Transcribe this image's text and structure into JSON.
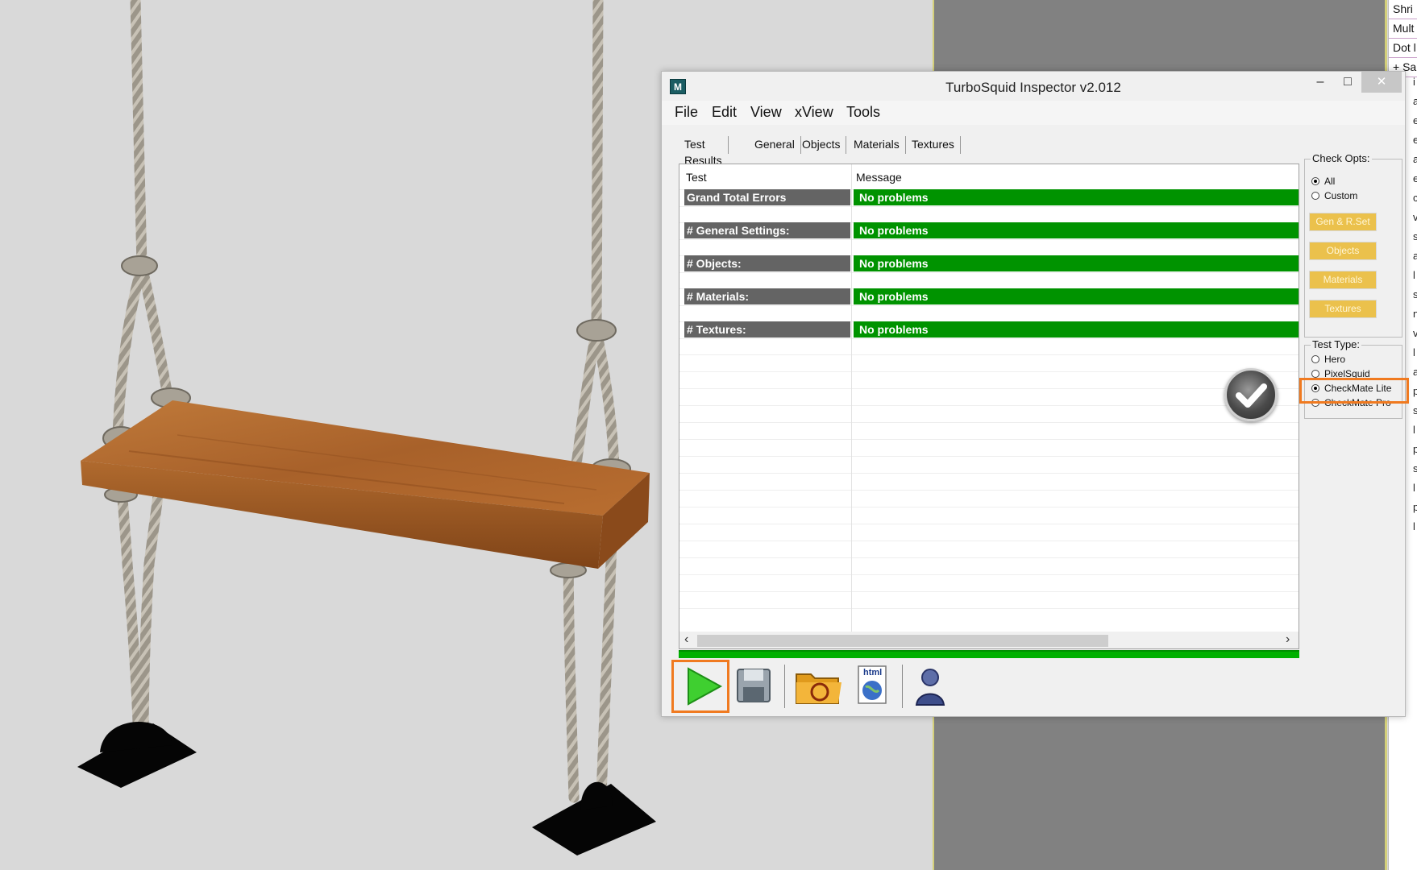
{
  "side_panel": {
    "rows": [
      "Shri",
      "Mult",
      "Dot l",
      "+ Sa"
    ],
    "letters": [
      "i",
      "a",
      "e",
      "e",
      "a",
      "e",
      "c",
      "v",
      "s",
      "a",
      "l",
      "s",
      "n",
      "v",
      "l",
      "a",
      "p",
      "s",
      "l",
      "p",
      "s",
      "l",
      "p",
      "l"
    ]
  },
  "window": {
    "app_icon": "M",
    "title": "TurboSquid Inspector v2.012",
    "minimize": "–",
    "maximize": "□",
    "close": "✕"
  },
  "menu": [
    "File",
    "Edit",
    "View",
    "xView",
    "Tools"
  ],
  "tabs": [
    "Test Results",
    "General",
    "Objects",
    "Materials",
    "Textures"
  ],
  "results": {
    "headers": {
      "test": "Test",
      "message": "Message"
    },
    "rows": [
      {
        "test": "Grand Total Errors",
        "message": "No problems"
      },
      {
        "test": "# General Settings:",
        "message": "No problems"
      },
      {
        "test": "# Objects:",
        "message": "No problems"
      },
      {
        "test": "# Materials:",
        "message": "No problems"
      },
      {
        "test": "# Textures:",
        "message": "No problems"
      }
    ],
    "scroll_left": "‹",
    "scroll_right": "›"
  },
  "check_opts": {
    "label": "Check Opts:",
    "radios": [
      {
        "label": "All",
        "selected": true
      },
      {
        "label": "Custom",
        "selected": false
      }
    ],
    "buttons": [
      "Gen & R.Set",
      "Objects",
      "Materials",
      "Textures"
    ]
  },
  "test_type": {
    "label": "Test Type:",
    "radios": [
      {
        "label": "Hero",
        "selected": false
      },
      {
        "label": "PixelSquid",
        "selected": false
      },
      {
        "label": "CheckMate Lite",
        "selected": true
      },
      {
        "label": "CheckMate Pro",
        "selected": false
      }
    ]
  },
  "toolbar": {
    "icons": [
      "play-icon",
      "save-icon",
      "open-folder-icon",
      "html-export-icon",
      "user-icon"
    ],
    "html_label": "html"
  },
  "colors": {
    "ok_green": "#009300",
    "highlight_orange": "#f07a20",
    "opt_button_gold": "#ebc14c",
    "row_label_gray": "#646464"
  }
}
